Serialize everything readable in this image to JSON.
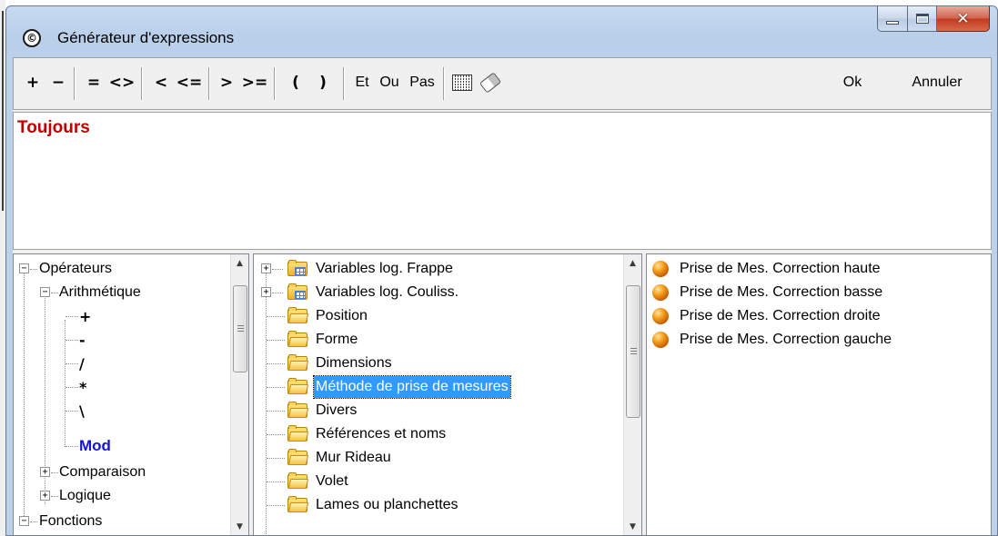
{
  "window": {
    "title": "Générateur d'expressions",
    "icon": "app-icon"
  },
  "toolbar": {
    "plus": "+",
    "minus": "−",
    "eq": "=",
    "neq": "<>",
    "lt": "<",
    "lte": "<=",
    "gt": ">",
    "gte": ">=",
    "lparen": "(",
    "rparen": ")",
    "and": "Et",
    "or": "Ou",
    "not": "Pas",
    "grid_icon": "table-icon",
    "eraser_icon": "eraser-icon",
    "ok": "Ok",
    "cancel": "Annuler"
  },
  "expression": {
    "text": "Toujours",
    "color": "#c00000"
  },
  "operators_tree": {
    "operateurs": "Opérateurs",
    "arithmetique": "Arithmétique",
    "leaves": [
      "+",
      "-",
      "/",
      "*",
      "\\",
      "Mod"
    ],
    "comparaison": "Comparaison",
    "logique": "Logique",
    "fonctions": "Fonctions"
  },
  "categories": [
    "Variables log. Frappe",
    "Variables log. Couliss.",
    "Position",
    "Forme",
    "Dimensions",
    "Méthode de prise de mesures",
    "Divers",
    "Références et noms",
    "Mur Rideau",
    "Volet",
    "Lames ou planchettes"
  ],
  "selected_category": "Méthode de prise de mesures",
  "variables": [
    "Prise de Mes. Correction haute",
    "Prise de Mes. Correction basse",
    "Prise de Mes. Correction droite",
    "Prise de Mes. Correction gauche"
  ],
  "colors": {
    "selection": "#3399ff",
    "mod_leaf": "#1414d6"
  }
}
